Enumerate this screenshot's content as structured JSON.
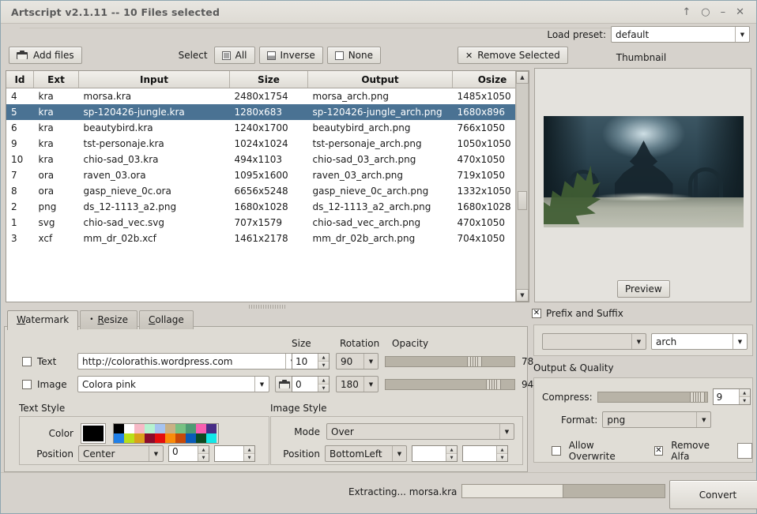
{
  "window": {
    "title": "Artscript v2.1.11 -- 10 Files selected",
    "buttons": [
      {
        "name": "shade",
        "glyph": "↑"
      },
      {
        "name": "rollup",
        "glyph": "○"
      },
      {
        "name": "minimize",
        "glyph": "–"
      },
      {
        "name": "close",
        "glyph": "✕"
      }
    ]
  },
  "toolbar": {
    "add_files": "Add files",
    "add_files_icon": "folder-icon",
    "select_label": "Select",
    "select_all": "All",
    "select_inverse": "Inverse",
    "select_none": "None",
    "remove_selected": "Remove Selected",
    "remove_icon": "✕"
  },
  "preset": {
    "label": "Load preset:",
    "value": "default"
  },
  "thumbnail": {
    "title": "Thumbnail",
    "preview_button": "Preview"
  },
  "file_list": {
    "columns": [
      "Id",
      "Ext",
      "Input",
      "Size",
      "Output",
      "Osize"
    ],
    "rows": [
      {
        "id": "4",
        "ext": "kra",
        "input": "morsa.kra",
        "size": "2480x1754",
        "output": "morsa_arch.png",
        "osize": "1485x1050",
        "selected": false
      },
      {
        "id": "5",
        "ext": "kra",
        "input": "sp-120426-jungle.kra",
        "size": "1280x683",
        "output": "sp-120426-jungle_arch.png",
        "osize": "1680x896",
        "selected": true
      },
      {
        "id": "6",
        "ext": "kra",
        "input": "beautybird.kra",
        "size": "1240x1700",
        "output": "beautybird_arch.png",
        "osize": "766x1050",
        "selected": false
      },
      {
        "id": "9",
        "ext": "kra",
        "input": "tst-personaje.kra",
        "size": "1024x1024",
        "output": "tst-personaje_arch.png",
        "osize": "1050x1050",
        "selected": false
      },
      {
        "id": "10",
        "ext": "kra",
        "input": "chio-sad_03.kra",
        "size": "494x1103",
        "output": "chio-sad_03_arch.png",
        "osize": "470x1050",
        "selected": false
      },
      {
        "id": "7",
        "ext": "ora",
        "input": "raven_03.ora",
        "size": "1095x1600",
        "output": "raven_03_arch.png",
        "osize": "719x1050",
        "selected": false
      },
      {
        "id": "8",
        "ext": "ora",
        "input": "gasp_nieve_0c.ora",
        "size": "6656x5248",
        "output": "gasp_nieve_0c_arch.png",
        "osize": "1332x1050",
        "selected": false
      },
      {
        "id": "2",
        "ext": "png",
        "input": "ds_12-1113_a2.png",
        "size": "1680x1028",
        "output": "ds_12-1113_a2_arch.png",
        "osize": "1680x1028",
        "selected": false
      },
      {
        "id": "1",
        "ext": "svg",
        "input": "chio-sad_vec.svg",
        "size": "707x1579",
        "output": "chio-sad_vec_arch.png",
        "osize": "470x1050",
        "selected": false
      },
      {
        "id": "3",
        "ext": "xcf",
        "input": "mm_dr_02b.xcf",
        "size": "1461x2178",
        "output": "mm_dr_02b_arch.png",
        "osize": "704x1050",
        "selected": false
      }
    ]
  },
  "tabs": [
    {
      "label": "Watermark",
      "active": true,
      "icon": ""
    },
    {
      "label": "Resize",
      "active": false,
      "icon": "•"
    },
    {
      "label": "Collage",
      "active": false,
      "icon": ""
    }
  ],
  "watermark": {
    "headers": {
      "size": "Size",
      "rotation": "Rotation",
      "opacity": "Opacity"
    },
    "text_row": {
      "checkbox_label": "Text",
      "checked": false,
      "value": "http://colorathis.wordpress.com",
      "size": "10",
      "rotation": "90",
      "opacity": "78"
    },
    "image_row": {
      "checkbox_label": "Image",
      "checked": false,
      "value": "Colora pink",
      "browse_icon": "folder-icon",
      "size": "0",
      "rotation": "180",
      "opacity": "94"
    },
    "text_style": {
      "title": "Text Style",
      "color_label": "Color",
      "current_color": "#000000",
      "palette": [
        "#000000",
        "#ffffff",
        "#f7b9c6",
        "#b5f2d0",
        "#a6c3f0",
        "#c9b184",
        "#77c183",
        "#4d9b74",
        "#f95fb0",
        "#472c86",
        "#1f7fe8",
        "#b9e019",
        "#dba01b",
        "#8c0b2c",
        "#e50d0d",
        "#f98c0a",
        "#c74a09",
        "#0a5cb8",
        "#0c4a22",
        "#11e8e8"
      ],
      "palette_row2_extra": [
        "#9b2aa0",
        "#f5f50c"
      ],
      "position_label": "Position",
      "position_value": "Center",
      "offset_x": "0",
      "offset_y": ""
    },
    "image_style": {
      "title": "Image Style",
      "mode_label": "Mode",
      "mode_value": "Over",
      "position_label": "Position",
      "position_value": "BottomLeft",
      "offset_x": "",
      "offset_y": ""
    }
  },
  "output": {
    "prefix_suffix_label": "Prefix and Suffix",
    "prefix_suffix_checked": true,
    "prefix_value": "",
    "suffix_value": "arch",
    "quality_title": "Output & Quality",
    "compress_label": "Compress:",
    "compress_value": "9",
    "format_label": "Format:",
    "format_value": "png",
    "allow_overwrite_label": "Allow Overwrite",
    "allow_overwrite_checked": false,
    "remove_alfa_label": "Remove Alfa",
    "remove_alfa_checked": true,
    "alfa_color": "#ffffff"
  },
  "status": {
    "text": "Extracting... morsa.kra",
    "progress": 50,
    "convert_button": "Convert"
  },
  "colors": {
    "selection": "#4a7293",
    "window_bg": "#d6d2cc",
    "panel_bg": "#dedbd4"
  }
}
